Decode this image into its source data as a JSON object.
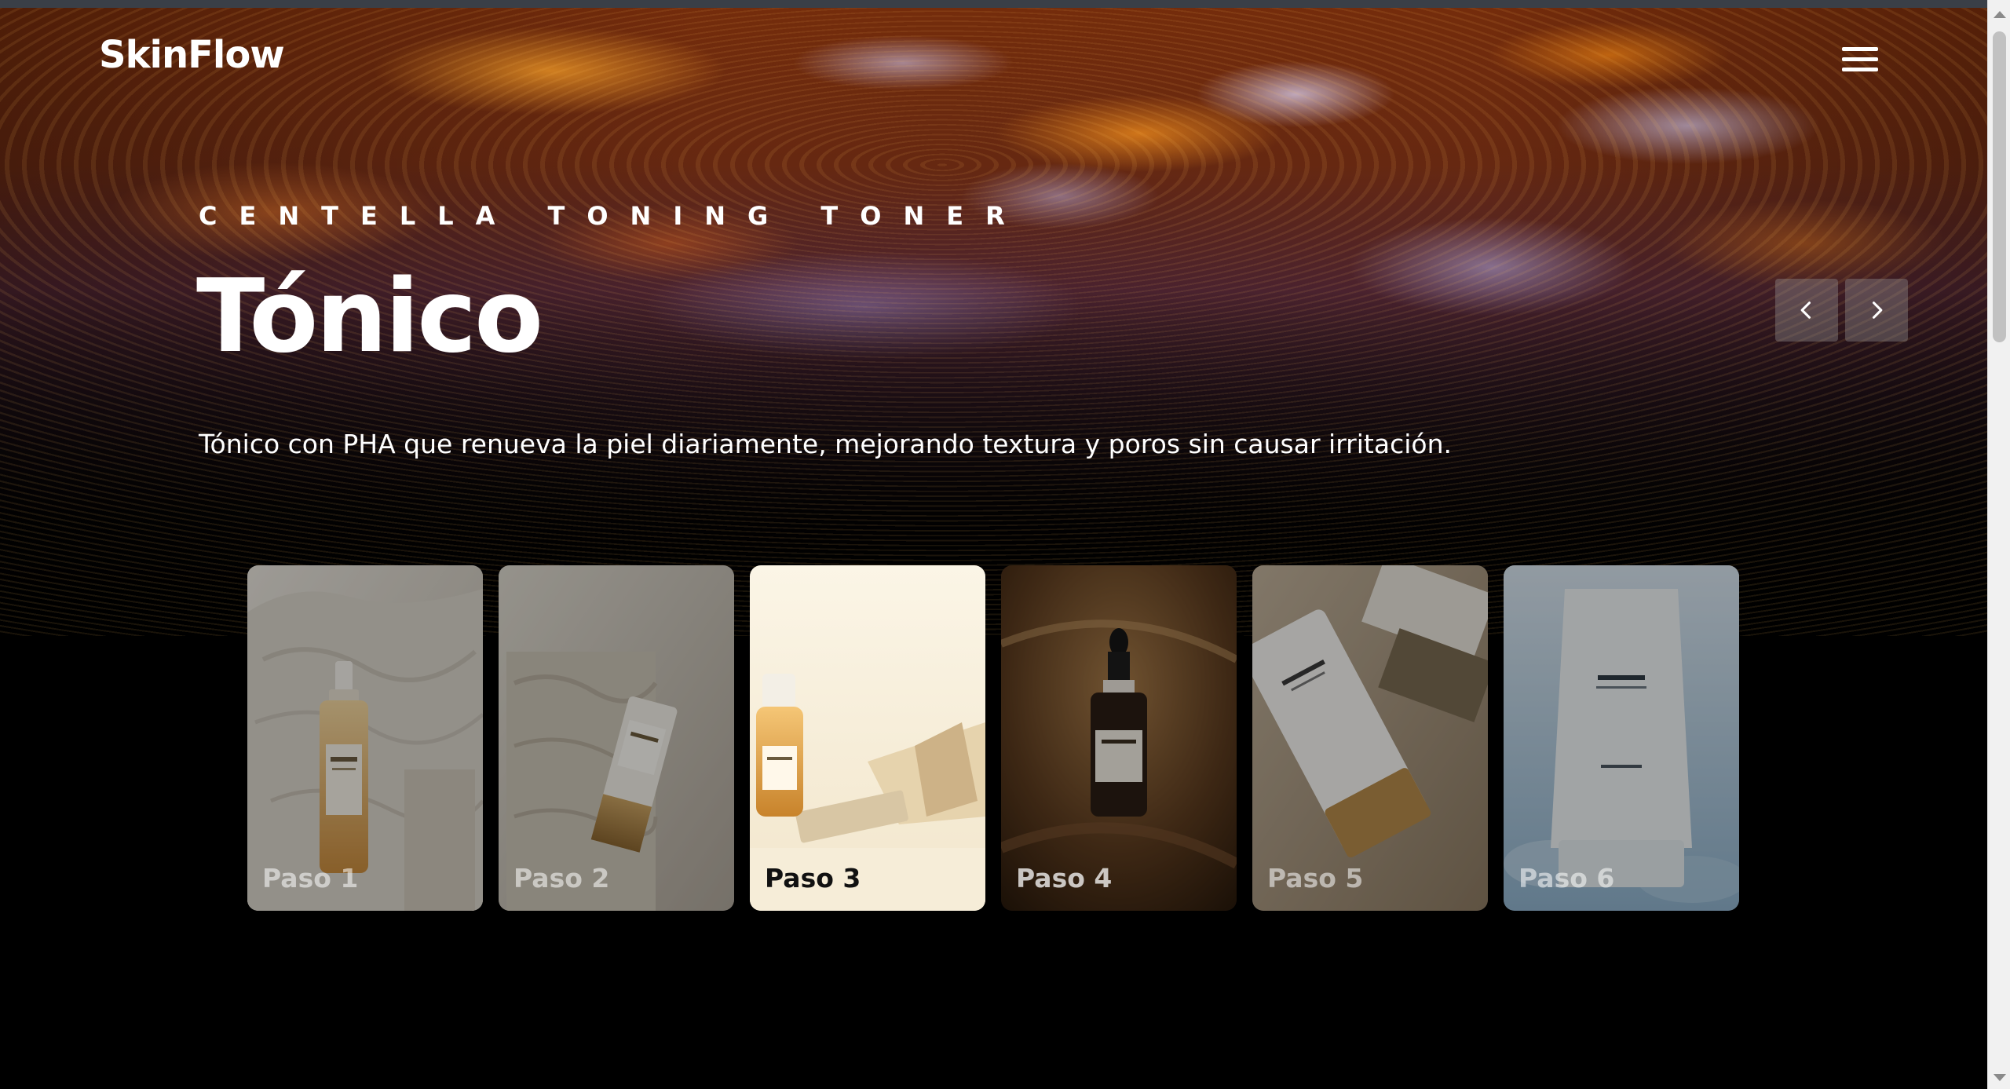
{
  "brand": {
    "logo": "SkinFlow"
  },
  "header": {
    "menu_icon": "hamburger-menu-icon"
  },
  "hero": {
    "subtitle": "CENTELLA TONING TONER",
    "title": "Tónico",
    "description": "Tónico con PHA que renueva la piel diariamente, mejorando textura y poros sin causar irritación.",
    "prev_icon": "chevron-left-icon",
    "next_icon": "chevron-right-icon"
  },
  "steps": {
    "active_index": 2,
    "items": [
      {
        "label": "Paso 1",
        "image": "cleansing-oil-bottle-on-stone"
      },
      {
        "label": "Paso 2",
        "image": "foam-cleanser-tube-on-stone"
      },
      {
        "label": "Paso 3",
        "image": "toner-bottle-in-sunlight"
      },
      {
        "label": "Paso 4",
        "image": "ampoule-dropper-bottle"
      },
      {
        "label": "Paso 5",
        "image": "cream-tube-on-sand"
      },
      {
        "label": "Paso 6",
        "image": "sun-serum-tube-on-water"
      }
    ]
  },
  "colors": {
    "background": "#000000",
    "text": "#ffffff",
    "arrow_button": "#6e6a70"
  }
}
